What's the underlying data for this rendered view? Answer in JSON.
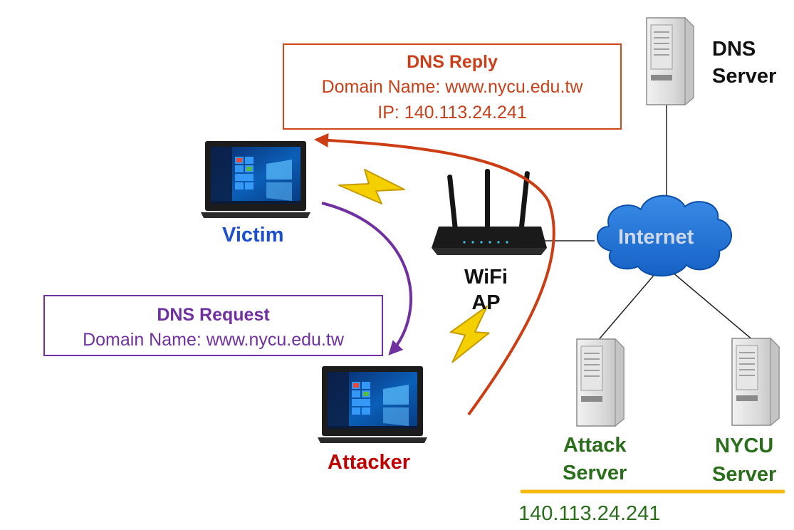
{
  "labels": {
    "dns_server": [
      "DNS",
      "Server"
    ],
    "victim": "Victim",
    "attacker": "Attacker",
    "wifi_ap": [
      "WiFi",
      "AP"
    ],
    "internet": "Internet",
    "attack_server": [
      "Attack",
      "Server"
    ],
    "nycu_server": [
      "NYCU",
      "Server"
    ],
    "ip_address": "140.113.24.241"
  },
  "dns_reply": {
    "title": "DNS Reply",
    "domain_line": "Domain Name: www.nycu.edu.tw",
    "ip_line": "IP: 140.113.24.241"
  },
  "dns_request": {
    "title": "DNS Request",
    "domain_line": "Domain Name: www.nycu.edu.tw"
  },
  "colors": {
    "reply": "#c8401a",
    "request": "#7030a0",
    "victim": "#1f4fd1",
    "attacker": "#c00000",
    "server_label": "#2a6e1c",
    "cloud": "#1f74d6",
    "highlight_line": "#f5b90f",
    "lightning": "#f5d000"
  }
}
